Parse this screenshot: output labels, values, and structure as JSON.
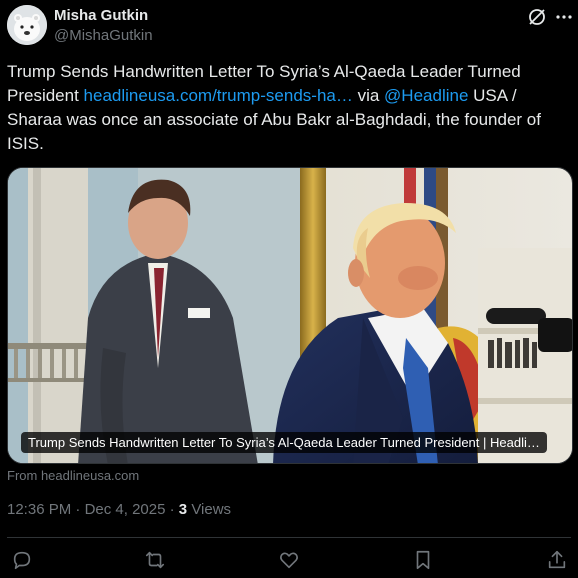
{
  "author": {
    "name": "Misha Gutkin",
    "handle": "@MishaGutkin",
    "avatar_icon": "polar-bear-avatar"
  },
  "tweet": {
    "text_part1": "Trump Sends Handwritten Letter To Syria’s Al-Qaeda Leader Turned President ",
    "link": "headlineusa.com/trump-sends-ha…",
    "text_part2": " via ",
    "mention": "@Headline",
    "text_part3": " USA / Sharaa was once an associate of Abu Bakr al-Baghdadi, the founder of ISIS."
  },
  "card": {
    "caption": "Trump Sends Handwritten Letter To Syria’s Al-Qaeda Leader Turned President | Headli…",
    "source": "From headlineusa.com"
  },
  "meta": {
    "time": "12:36 PM",
    "separator": "·",
    "date": "Dec 4, 2025",
    "views_count": "3",
    "views_label": "Views"
  },
  "header_icons": {
    "grok": "grok-icon",
    "more": "more-icon"
  },
  "actions": [
    {
      "name": "reply-icon"
    },
    {
      "name": "retweet-icon"
    },
    {
      "name": "like-icon"
    },
    {
      "name": "bookmark-icon"
    },
    {
      "name": "share-icon"
    }
  ],
  "colors": {
    "background": "#000000",
    "text": "#e7e9ea",
    "secondary": "#71767b",
    "link": "#1d9bf0",
    "border": "#2f3336"
  }
}
